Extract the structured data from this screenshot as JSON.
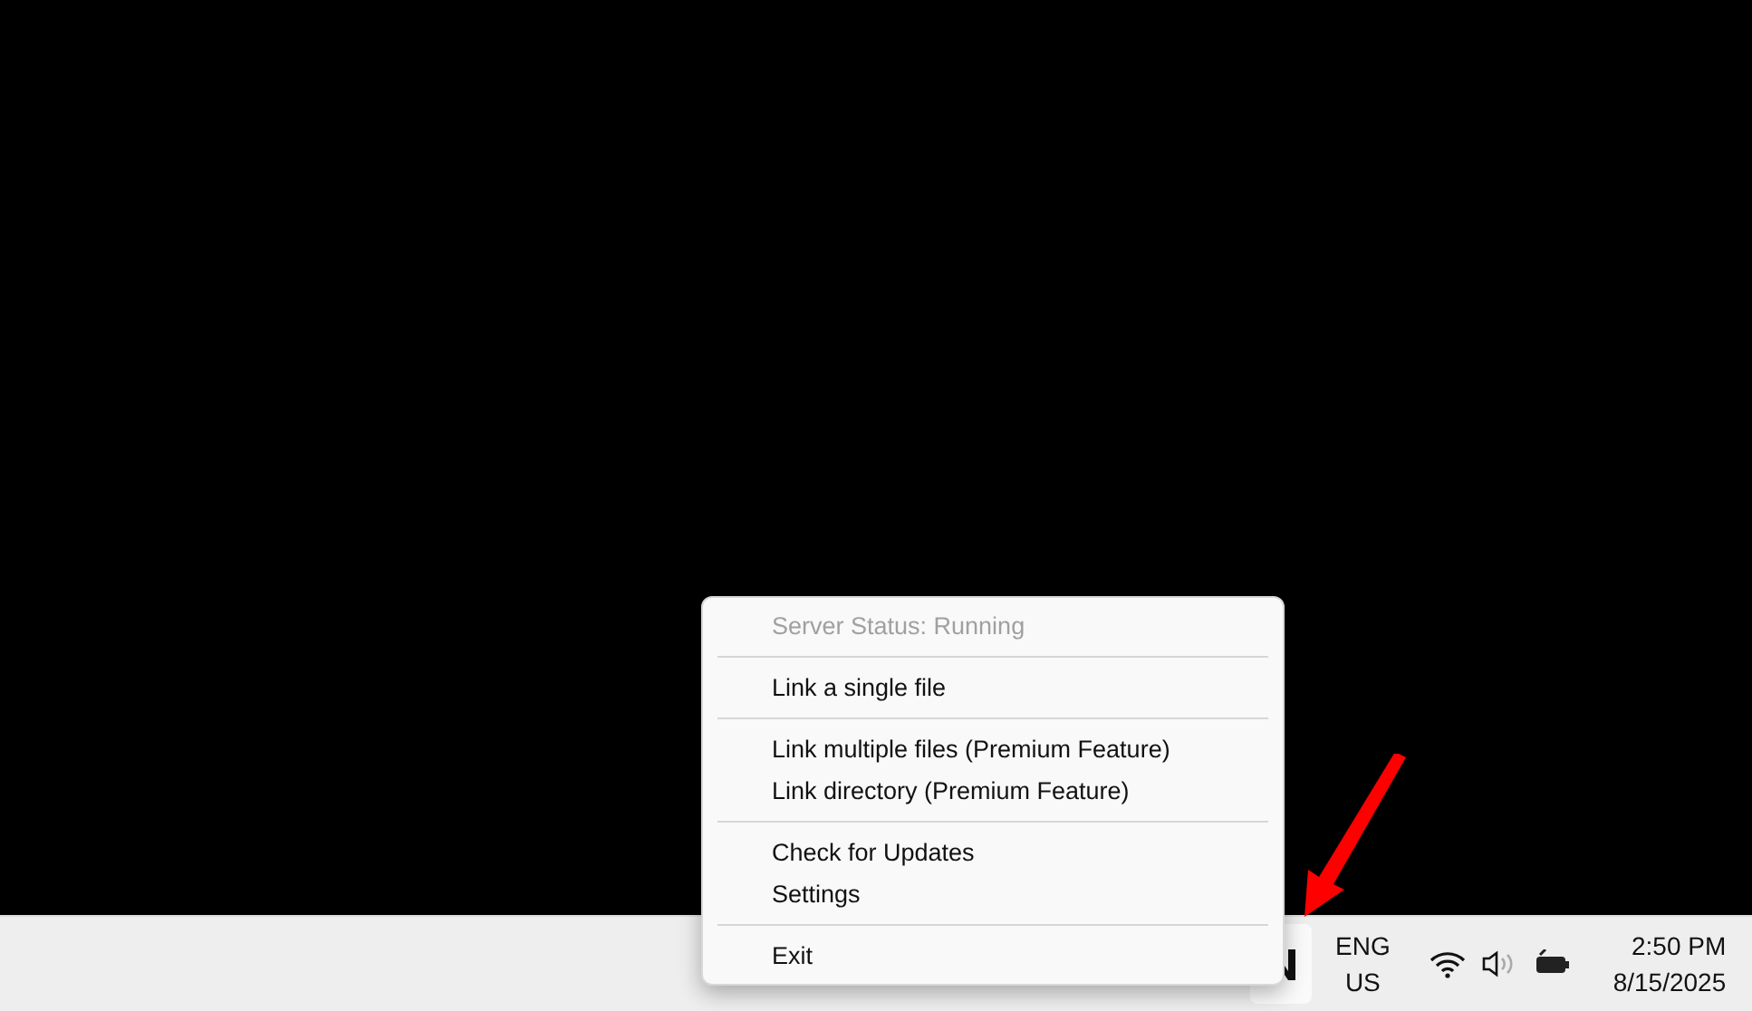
{
  "context_menu": {
    "groups": [
      {
        "items": [
          {
            "label": "Server Status: Running",
            "disabled": true
          }
        ]
      },
      {
        "items": [
          {
            "label": "Link a single file",
            "disabled": false
          }
        ]
      },
      {
        "items": [
          {
            "label": "Link multiple files (Premium Feature)",
            "disabled": false
          },
          {
            "label": "Link directory (Premium Feature)",
            "disabled": false
          }
        ]
      },
      {
        "items": [
          {
            "label": "Check for Updates",
            "disabled": false
          },
          {
            "label": "Settings",
            "disabled": false
          }
        ]
      },
      {
        "items": [
          {
            "label": "Exit",
            "disabled": false
          }
        ]
      }
    ]
  },
  "taskbar": {
    "language": {
      "primary": "ENG",
      "secondary": "US"
    },
    "clock": {
      "time": "2:50 PM",
      "date": "8/15/2025"
    }
  }
}
